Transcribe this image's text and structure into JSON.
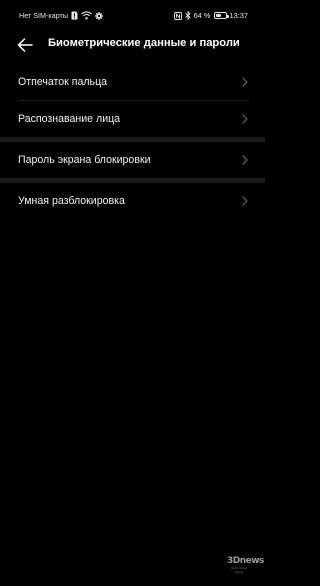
{
  "status_bar": {
    "carrier": "Нет SIM-карты",
    "battery_percent": "64 %",
    "battery_level": 0.64,
    "time": "13:37",
    "left_icons": [
      "sim-missing-icon",
      "wifi-icon",
      "gear-icon"
    ],
    "right_icons": [
      "nfc-icon",
      "bluetooth-icon",
      "battery-icon"
    ]
  },
  "header": {
    "back_icon": "arrow-left-icon",
    "title": "Биометрические данные и пароли"
  },
  "list": {
    "items": [
      {
        "label": "Отпечаток пальца",
        "icon": "chevron-right-icon"
      },
      {
        "label": "Распознавание лица",
        "icon": "chevron-right-icon"
      },
      {
        "label": "Пароль экрана блокировки",
        "icon": "chevron-right-icon"
      },
      {
        "label": "Умная разблокировка",
        "icon": "chevron-right-icon"
      }
    ]
  },
  "watermark": {
    "logo": "3Dnews",
    "tagline": "Daily Digital Digest"
  },
  "colors": {
    "background": "#000000",
    "text": "#f2f2f2",
    "divider": "#1c1c1c",
    "group_separator": "#1a1a1a",
    "chevron": "#6e6e6e"
  }
}
